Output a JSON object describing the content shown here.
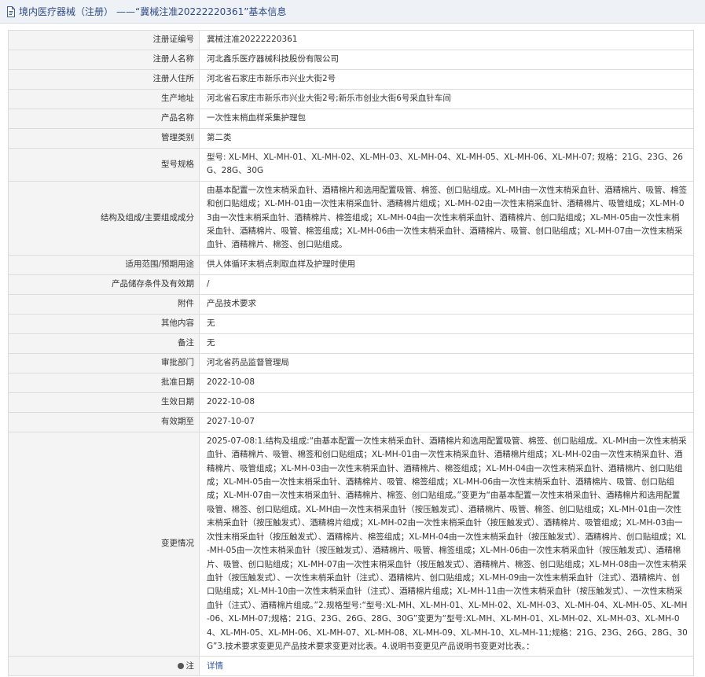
{
  "header": {
    "category": "境内医疗器械（注册）",
    "title": "——“冀械注准20222220361”基本信息"
  },
  "rows": [
    {
      "label": "注册证编号",
      "value": "冀械注准20222220361"
    },
    {
      "label": "注册人名称",
      "value": "河北鑫乐医疗器械科技股份有限公司"
    },
    {
      "label": "注册人住所",
      "value": "河北省石家庄市新乐市兴业大街2号"
    },
    {
      "label": "生产地址",
      "value": "河北省石家庄市新乐市兴业大街2号;新乐市创业大街6号采血针车间"
    },
    {
      "label": "产品名称",
      "value": "一次性末梢血样采集护理包"
    },
    {
      "label": "管理类别",
      "value": "第二类"
    },
    {
      "label": "型号规格",
      "value": "型号: XL-MH、XL-MH-01、XL-MH-02、XL-MH-03、XL-MH-04、XL-MH-05、XL-MH-06、XL-MH-07; 规格：21G、23G、26G、28G、30G"
    },
    {
      "label": "结构及组成/主要组成成分",
      "value": "由基本配置一次性末梢采血针、酒精棉片和选用配置吸管、棉签、创口贴组成。XL-MH由一次性末梢采血针、酒精棉片、吸管、棉签和创口贴组成；XL-MH-01由一次性末梢采血针、酒精棉片组成；XL-MH-02由一次性末梢采血针、酒精棉片、吸管组成；XL-MH-03由一次性末梢采血针、酒精棉片、棉签组成；XL-MH-04由一次性末梢采血针、酒精棉片、创口贴组成；XL-MH-05由一次性末梢采血针、酒精棉片、吸管、棉签组成；XL-MH-06由一次性末梢采血针、酒精棉片、吸管、创口贴组成；XL-MH-07由一次性末梢采血针、酒精棉片、棉签、创口贴组成。"
    },
    {
      "label": "适用范围/预期用途",
      "value": "供人体循环末梢点刺取血样及护理时使用"
    },
    {
      "label": "产品储存条件及有效期",
      "value": "/"
    },
    {
      "label": "附件",
      "value": "产品技术要求"
    },
    {
      "label": "其他内容",
      "value": "无"
    },
    {
      "label": "备注",
      "value": "无"
    },
    {
      "label": "审批部门",
      "value": "河北省药品监督管理局"
    },
    {
      "label": "批准日期",
      "value": "2022-10-08"
    },
    {
      "label": "生效日期",
      "value": "2022-10-08"
    },
    {
      "label": "有效期至",
      "value": "2027-10-07"
    },
    {
      "label": "变更情况",
      "value": "2025-07-08:1.结构及组成:“由基本配置一次性末梢采血针、酒精棉片和选用配置吸管、棉签、创口贴组成。XL-MH由一次性末梢采血针、酒精棉片、吸管、棉签和创口贴组成；XL-MH-01由一次性末梢采血针、酒精棉片组成；XL-MH-02由一次性末梢采血针、酒精棉片、吸管组成；XL-MH-03由一次性末梢采血针、酒精棉片、棉签组成；XL-MH-04由一次性末梢采血针、酒精棉片、创口贴组成；XL-MH-05由一次性末梢采血针、酒精棉片、吸管、棉签组成；XL-MH-06由一次性末梢采血针、酒精棉片、吸管、创口贴组成；XL-MH-07由一次性末梢采血针、酒精棉片、棉签、创口贴组成。”变更为“由基本配置一次性末梢采血针、酒精棉片和选用配置吸管、棉签、创口贴组成。XL-MH由一次性末梢采血针（按压触发式）、酒精棉片、吸管、棉签、创口贴组成；XL-MH-01由一次性末梢采血针（按压触发式）、酒精棉片组成；XL-MH-02由一次性末梢采血针（按压触发式）、酒精棉片、吸管组成；XL-MH-03由一次性末梢采血针（按压触发式）、酒精棉片、棉签组成；XL-MH-04由一次性末梢采血针（按压触发式）、酒精棉片、创口贴组成；XL-MH-05由一次性末梢采血针（按压触发式）、酒精棉片、吸管、棉签组成；XL-MH-06由一次性末梢采血针（按压触发式）、酒精棉片、吸管、创口贴组成；XL-MH-07由一次性末梢采血针（按压触发式）、酒精棉片、棉签、创口贴组成；XL-MH-08由一次性末梢采血针（按压触发式）、一次性末梢采血针（注式）、酒精棉片、创口贴组成；XL-MH-09由一次性末梢采血针（注式）、酒精棉片、创口贴组成；XL-MH-10由一次性末梢采血针（注式）、酒精棉片组成；XL-MH-11由一次性末梢采血针（按压触发式）、一次性末梢采血针（注式）、酒精棉片组成。”2.规格型号:“型号:XL-MH、XL-MH-01、XL-MH-02、XL-MH-03、XL-MH-04、XL-MH-05、XL-MH-06、XL-MH-07;规格：21G、23G、26G、28G、30G”变更为“型号:XL-MH、XL-MH-01、XL-MH-02、XL-MH-03、XL-MH-04、XL-MH-05、XL-MH-06、XL-MH-07、XL-MH-08、XL-MH-09、XL-MH-10、XL-MH-11;规格：21G、23G、26G、28G、30G”3.技术要求变更见产品技术要求变更对比表。4.说明书变更见产品说明书变更对比表。："
    }
  ],
  "note_row": {
    "label": "注",
    "link_text": "详情"
  }
}
